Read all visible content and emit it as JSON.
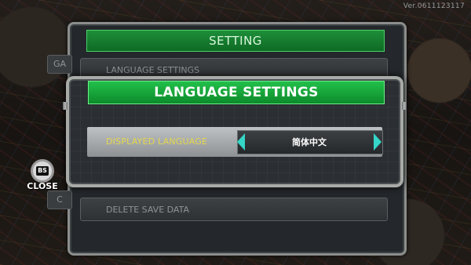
{
  "version": "Ver.0611123117",
  "back_panel": {
    "title": "SETTING",
    "row_language": "LANGUAGE SETTINGS",
    "row_delete": "DELETE SAVE DATA",
    "side_stub_top": "GA",
    "side_stub_bottom": "C"
  },
  "dialog": {
    "title": "LANGUAGE SETTINGS",
    "displayed_language_label": "DISPLAYED LANGUAGE",
    "selected_language": "简体中文"
  },
  "close_button": {
    "key": "BS",
    "label": "CLOSE"
  },
  "colors": {
    "header_green": "#0d8a2b",
    "label_yellow": "#e5d84b",
    "arrow_cyan": "#35d6c8"
  },
  "icons": [
    "arrow-left-icon",
    "arrow-right-icon",
    "gear-icon"
  ]
}
